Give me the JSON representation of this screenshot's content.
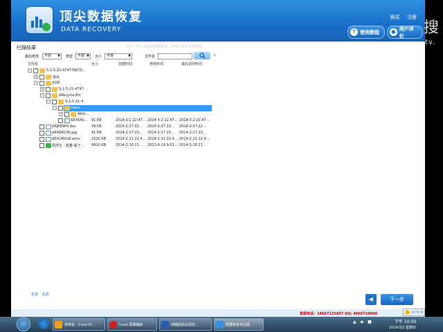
{
  "header": {
    "brand_cn": "顶尖数据恢复",
    "brand_en": "DATA RECOVERY",
    "links": [
      "购买",
      "注册"
    ],
    "buttons": {
      "tutorial": "使用教程",
      "review": "用户评价"
    }
  },
  "scan": {
    "title": "扫描结果",
    "hint": "用户：可以对您的数据恢复，也可以按文件名搜索",
    "filters": {
      "modified_label": "最后修改",
      "modified_value": "不限",
      "type_label": "类型",
      "type_value": "不限",
      "size_label": "大小",
      "size_value": "不限",
      "filename_label": "文件名"
    },
    "columns": [
      "文件名",
      "大小",
      "创建时间",
      "修改时间",
      "最后访问时间"
    ],
    "rows": [
      {
        "name": "S-1-5-21-474778670...",
        "size": "",
        "created": "",
        "modified": "",
        "accessed": ""
      },
      {
        "name": "流水",
        "size": "",
        "created": "",
        "modified": "",
        "accessed": ""
      },
      {
        "name": "KDR",
        "size": "",
        "created": "",
        "modified": "",
        "accessed": ""
      },
      {
        "name": "S-1-5-21-4747...",
        "size": "",
        "created": "",
        "modified": "",
        "accessed": ""
      },
      {
        "name": "$Recycle.Bin",
        "size": "",
        "created": "",
        "modified": "",
        "accessed": ""
      },
      {
        "name": "S-1-5-21-4...",
        "size": "",
        "created": "",
        "modified": "",
        "accessed": ""
      },
      {
        "name": "Users",
        "size": "",
        "created": "",
        "modified": "",
        "accessed": ""
      },
      {
        "name": "Adm...",
        "size": "",
        "created": "",
        "modified": "",
        "accessed": ""
      },
      {
        "name": "$RX6AV...",
        "size": "91 KB",
        "created": "2014-3-2 22:47...",
        "modified": "2014-3-2 22:47...",
        "accessed": "2014-3-2 22:47..."
      },
      {
        "name": "$RJKB9P9.doc",
        "size": "39 KB",
        "created": "2014-2-27 22...",
        "modified": "2014-2-27 22...",
        "accessed": "2014-2-27 22..."
      },
      {
        "name": "$RX6AV3N.jpg",
        "size": "91 KB",
        "created": "2014-2-27 23...",
        "modified": "2014-2-27 23...",
        "accessed": "2014-2-27 23..."
      },
      {
        "name": "$RXLM2UA.wmv",
        "size": "2320 KB",
        "created": "2014-2-11 22:4...",
        "modified": "2014-2-11 22:4...",
        "accessed": "2014-2-11 22:4..."
      },
      {
        "name": "周杰伦 - 稻香-看了...",
        "size": "9910 KB",
        "created": "2014-2-18 21...",
        "modified": "2013-9-19 9:51...",
        "accessed": "2014-2-18 21..."
      }
    ]
  },
  "footer": {
    "links": [
      "全选",
      "反选"
    ],
    "next": "下一步",
    "hotline": "客服电话：18667133607  QQ: 4006718068",
    "qq_online": "QQ在线"
  },
  "watermark": {
    "line1": "搜",
    "line2": "tv."
  },
  "taskbar": {
    "tasks": [
      {
        "label": "未命名 - Corel Vi...",
        "color": "#f0a020"
      },
      {
        "label": "Corel 屏幕捕获",
        "color": "#d02020"
      },
      {
        "label": "电脑回收站清空...",
        "color": "#2a5db0"
      },
      {
        "label": "数据恢复专业版",
        "color": "#3a8ee0"
      }
    ],
    "time": "下午 10:59",
    "date": "2014/3/2 星期日"
  }
}
